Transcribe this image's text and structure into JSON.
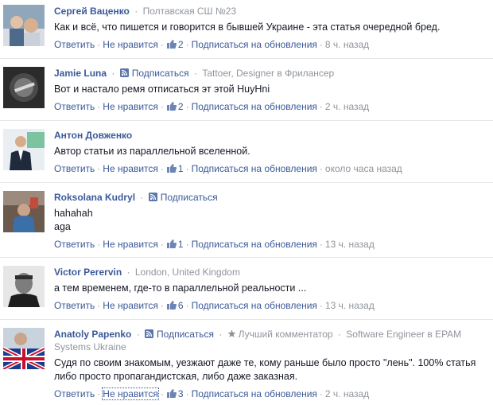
{
  "labels": {
    "reply": "Ответить",
    "dislike": "Не нравится",
    "subscribe_updates": "Подписаться на обновления",
    "subscribe": "Подписаться",
    "dot": "·"
  },
  "colors": {
    "link": "#3b5998",
    "meta": "#90949c",
    "text": "#141823"
  },
  "comments": [
    {
      "author": "Сергей Ваценко",
      "meta": "Полтавская СШ №23",
      "text": "Как и всё, что пишется и говорится в бывшей Украине - эта статья очередной бред.",
      "likes": "2",
      "time": "8 ч. назад"
    },
    {
      "author": "Jamie Luna",
      "subscribe": "Подписаться",
      "meta": "Tattoer, Designer в Фрилансер",
      "text": "Вот и настало ремя отписаться эт этой HuyHni",
      "likes": "2",
      "time": "2 ч. назад"
    },
    {
      "author": "Антон Довженко",
      "text": "Автор статьи из параллельной вселенной.",
      "likes": "1",
      "time": "около часа назад"
    },
    {
      "author": "Roksolana Kudryl",
      "subscribe": "Подписаться",
      "text_line1": "hahahah",
      "text_line2": "aga",
      "likes": "1",
      "time": "13 ч. назад"
    },
    {
      "author": "Victor Perervin",
      "meta": "London, United Kingdom",
      "text": "а тем временем, где-то в параллельной реальности ...",
      "likes": "6",
      "time": "13 ч. назад"
    },
    {
      "author": "Anatoly Papenko",
      "subscribe": "Подписаться",
      "badge": "Лучший комментатор",
      "meta": "Software Engineer в EPAM Systems Ukraine",
      "text": "Судя по своим знакомым, уезжают даже те, кому раньше было просто \"лень\". 100% статья либо просто пропагандистская, либо даже заказная.",
      "likes": "3",
      "time": "2 ч. назад"
    }
  ]
}
